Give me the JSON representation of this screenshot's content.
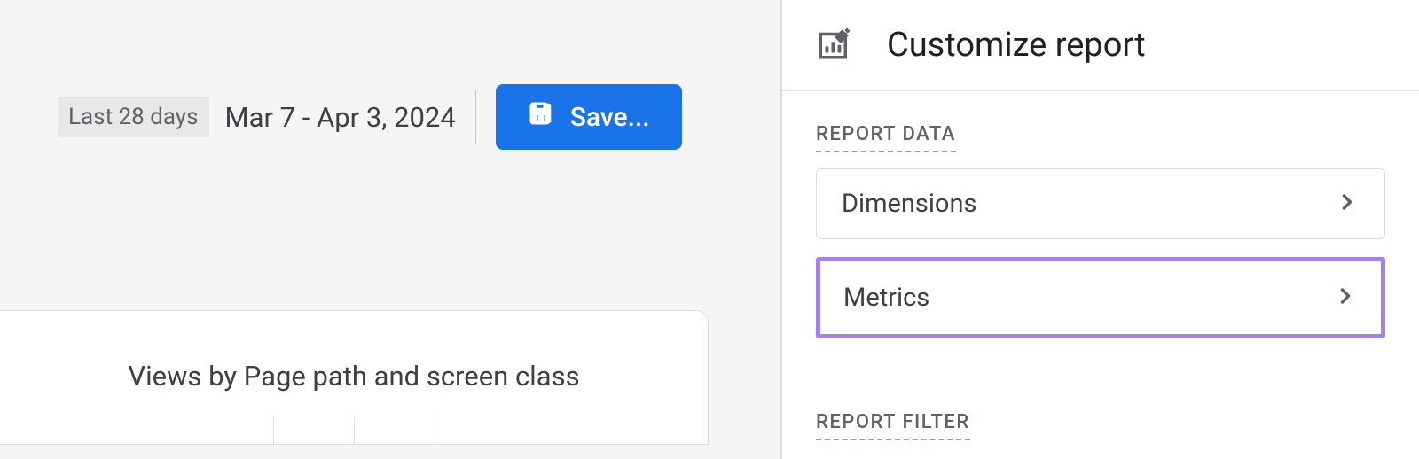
{
  "main": {
    "date_range_label": "Last 28 days",
    "date_range_value": "Mar 7 - Apr 3, 2024",
    "save_button_label": "Save...",
    "card_title": "Views by Page path and screen class"
  },
  "panel": {
    "title": "Customize report",
    "section_report_data": "REPORT DATA",
    "section_report_filter": "REPORT FILTER",
    "options": {
      "dimensions": "Dimensions",
      "metrics": "Metrics"
    }
  }
}
